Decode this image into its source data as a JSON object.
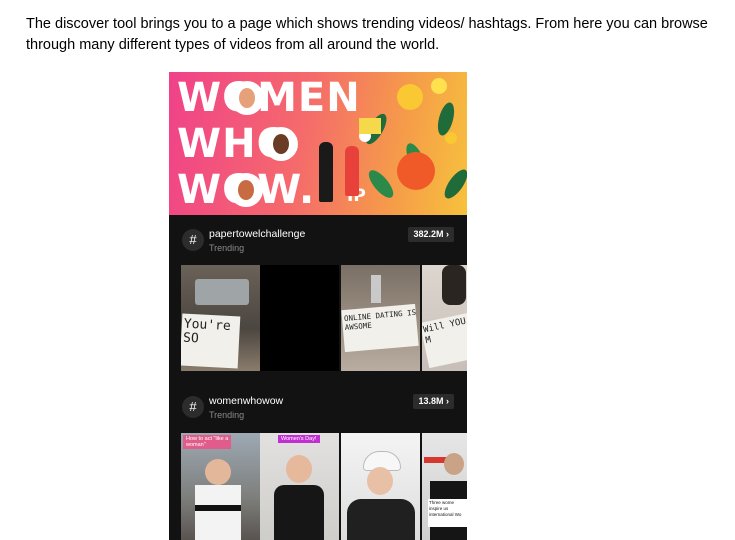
{
  "intro_text": "The discover tool brings you to a page which shows trending videos/ hashtags. From here you can browse through many different types of videos from all around the world.",
  "banner": {
    "lines": [
      "WOMEN",
      "WHO",
      "WOW."
    ],
    "ip": "IP",
    "colors": {
      "start": "#f0418a",
      "end": "#f7c23c"
    }
  },
  "hashtags": [
    {
      "icon": "#",
      "name": "papertowelchallenge",
      "status": "Trending",
      "count": "382.2M",
      "thumb_texts": [
        "You're\nSO",
        "",
        "ONLINE DATING IS\nAWSOME",
        "Will YOU\nM"
      ]
    },
    {
      "icon": "#",
      "name": "womenwhowow",
      "status": "Trending",
      "count": "13.8M",
      "thumb_texts": [
        "How to act \"like a\nwoman\"",
        "Women's Day!",
        "",
        "Three wome\ninspire us\ninternational Wo"
      ]
    }
  ],
  "chevron": "›"
}
